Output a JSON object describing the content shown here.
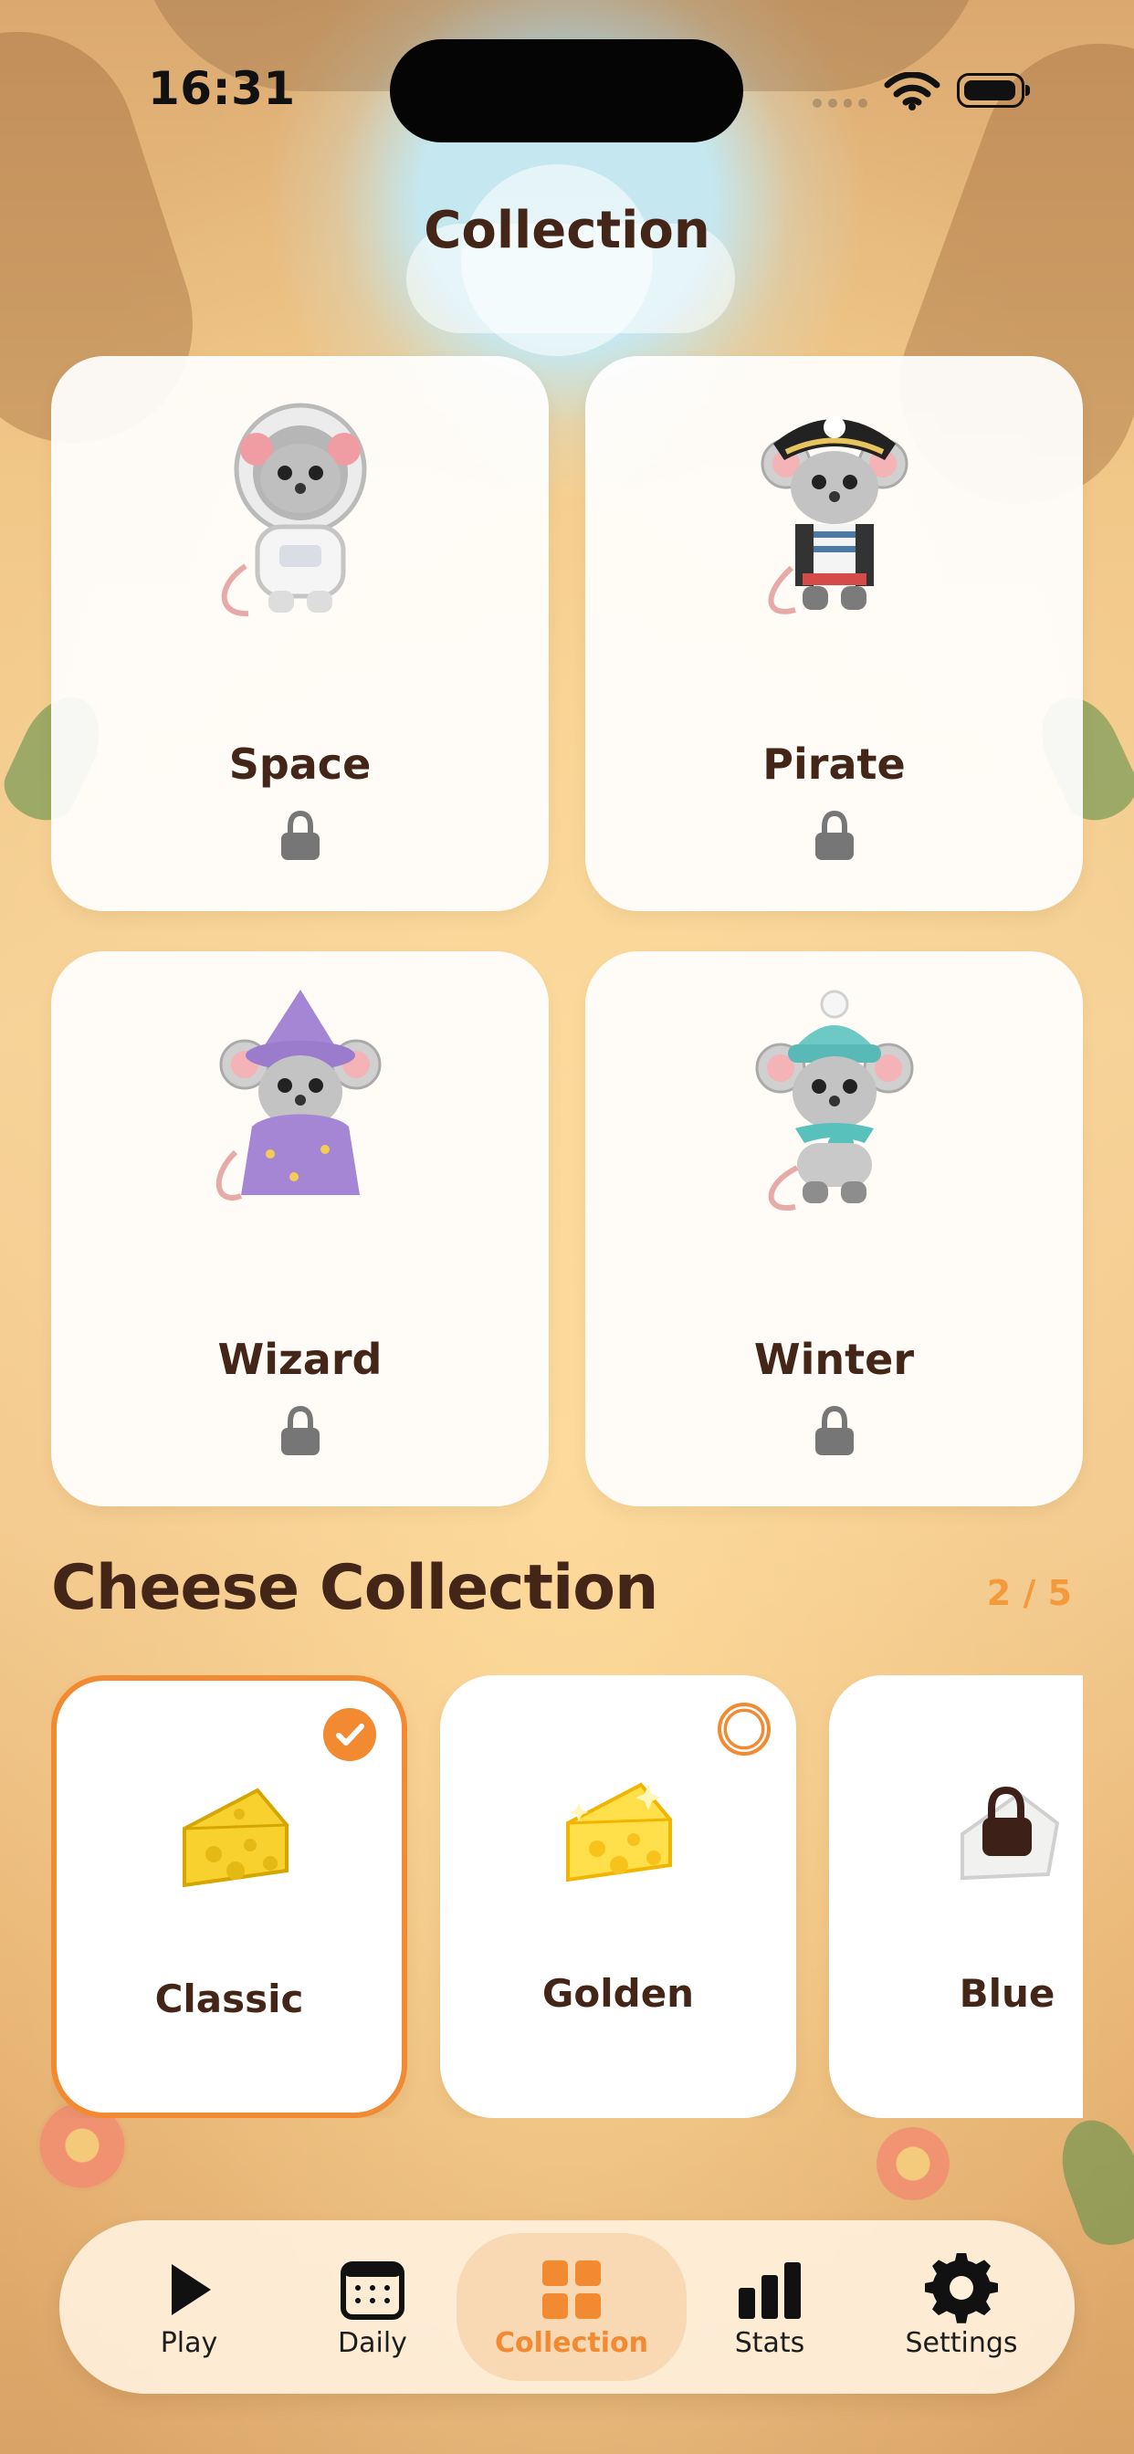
{
  "status_bar": {
    "time": "16:31"
  },
  "page": {
    "title": "Collection",
    "colors": {
      "text": "#432618",
      "accent": "#F28A31",
      "card": "#FFFFFF"
    }
  },
  "outfits": {
    "items": [
      {
        "label": "Space",
        "status": "locked",
        "icon": "space-mouse-icon"
      },
      {
        "label": "Pirate",
        "status": "locked",
        "icon": "pirate-mouse-icon"
      },
      {
        "label": "Wizard",
        "status": "locked",
        "icon": "wizard-mouse-icon"
      },
      {
        "label": "Winter",
        "status": "locked",
        "icon": "winter-mouse-icon"
      }
    ]
  },
  "cheese_collection": {
    "title": "Cheese Collection",
    "count": "2 / 5",
    "items": [
      {
        "label": "Classic",
        "selected": true,
        "locked": false,
        "icon": "classic-cheese-icon"
      },
      {
        "label": "Golden",
        "selected": false,
        "locked": false,
        "icon": "golden-cheese-icon"
      },
      {
        "label": "Blue",
        "selected": false,
        "locked": true,
        "icon": "blue-cheese-locked-icon"
      }
    ]
  },
  "tab_bar": {
    "items": [
      {
        "label": "Play",
        "icon": "play-icon",
        "active": false
      },
      {
        "label": "Daily",
        "icon": "calendar-icon",
        "active": false
      },
      {
        "label": "Collection",
        "icon": "grid-icon",
        "active": true
      },
      {
        "label": "Stats",
        "icon": "bar-chart-icon",
        "active": false
      },
      {
        "label": "Settings",
        "icon": "gear-icon",
        "active": false
      }
    ]
  }
}
